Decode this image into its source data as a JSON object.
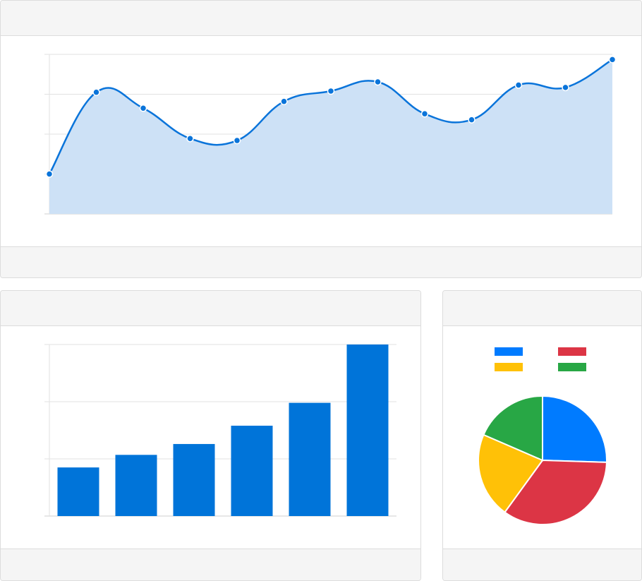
{
  "cards": {
    "area": {
      "header": "",
      "footer": ""
    },
    "bar": {
      "header": "",
      "footer": ""
    },
    "pie": {
      "header": "",
      "footer": ""
    }
  },
  "colors": {
    "line": "#0a74da",
    "area_fill": "#cde1f6",
    "bar": "#0074d9",
    "grid": "#e2e2e2",
    "axis": "#cfcfcf",
    "pie": [
      "#007bff",
      "#dc3545",
      "#ffc107",
      "#28a745"
    ]
  },
  "chart_data": [
    {
      "type": "area",
      "title": "",
      "x": [
        1,
        2,
        3,
        4,
        5,
        6,
        7,
        8,
        9,
        10,
        11,
        12,
        13
      ],
      "series": [
        {
          "values": [
            10,
            30.5,
            26.5,
            18.9,
            18.4,
            28.2,
            30.8,
            33.1,
            25.1,
            23.6,
            32.3,
            31.7,
            38.7
          ]
        }
      ],
      "ylim": [
        0,
        40
      ],
      "grid": true
    },
    {
      "type": "bar",
      "title": "",
      "categories": [
        "",
        "",
        "",
        "",
        "",
        ""
      ],
      "values": [
        8.5,
        10.7,
        12.6,
        15.8,
        19.8,
        30
      ],
      "ylim": [
        0,
        30
      ],
      "grid": true
    },
    {
      "type": "pie",
      "title": "",
      "labels": [
        "",
        "",
        "",
        ""
      ],
      "values": [
        25.5,
        34.5,
        21.5,
        18.5
      ],
      "legend": "top"
    }
  ]
}
